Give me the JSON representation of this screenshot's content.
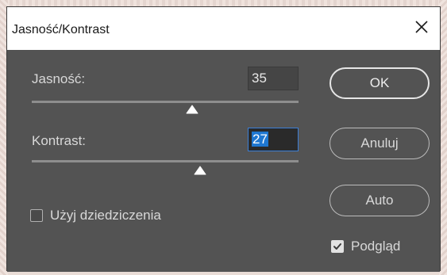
{
  "dialog": {
    "title": "Jasność/Kontrast",
    "close_icon": "close-x-icon"
  },
  "brightness": {
    "label": "Jasność:",
    "value": "35",
    "level": 0.6
  },
  "contrast": {
    "label": "Kontrast:",
    "value": "27",
    "level": 0.63
  },
  "buttons": {
    "ok": "OK",
    "cancel": "Anuluj",
    "auto": "Auto"
  },
  "use_legacy": {
    "label": "Użyj dziedziczenia",
    "checked": false
  },
  "preview": {
    "label": "Podgląd",
    "checked": true
  },
  "colors": {
    "panel_bg": "#535353",
    "focus_accent": "#1f77d0"
  }
}
